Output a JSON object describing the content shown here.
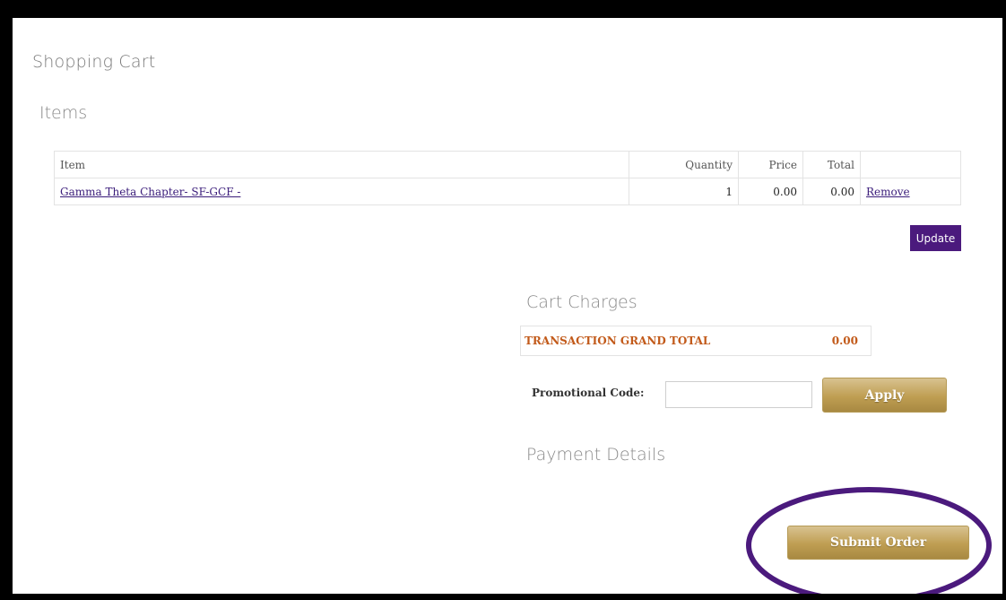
{
  "page": {
    "title": "Shopping Cart"
  },
  "items_section": {
    "title": "Items",
    "columns": {
      "item": "Item",
      "quantity": "Quantity",
      "price": "Price",
      "total": "Total"
    },
    "rows": [
      {
        "item": "Gamma Theta Chapter- SF-GCF - ",
        "quantity": "1",
        "price": "0.00",
        "total": "0.00",
        "action": "Remove"
      }
    ],
    "update_label": "Update"
  },
  "cart_charges": {
    "title": "Cart Charges",
    "grand_total_label": "TRANSACTION GRAND TOTAL",
    "grand_total_value": "0.00"
  },
  "promo": {
    "label": "Promotional Code:",
    "value": "",
    "placeholder": "",
    "apply_label": "Apply"
  },
  "payment": {
    "title": "Payment Details"
  },
  "submit": {
    "label": "Submit Order"
  },
  "colors": {
    "accent_purple": "#4b1a7d",
    "gold": "#bf9e52",
    "total_orange": "#c25a1a",
    "highlight": "#4b1a7d"
  }
}
